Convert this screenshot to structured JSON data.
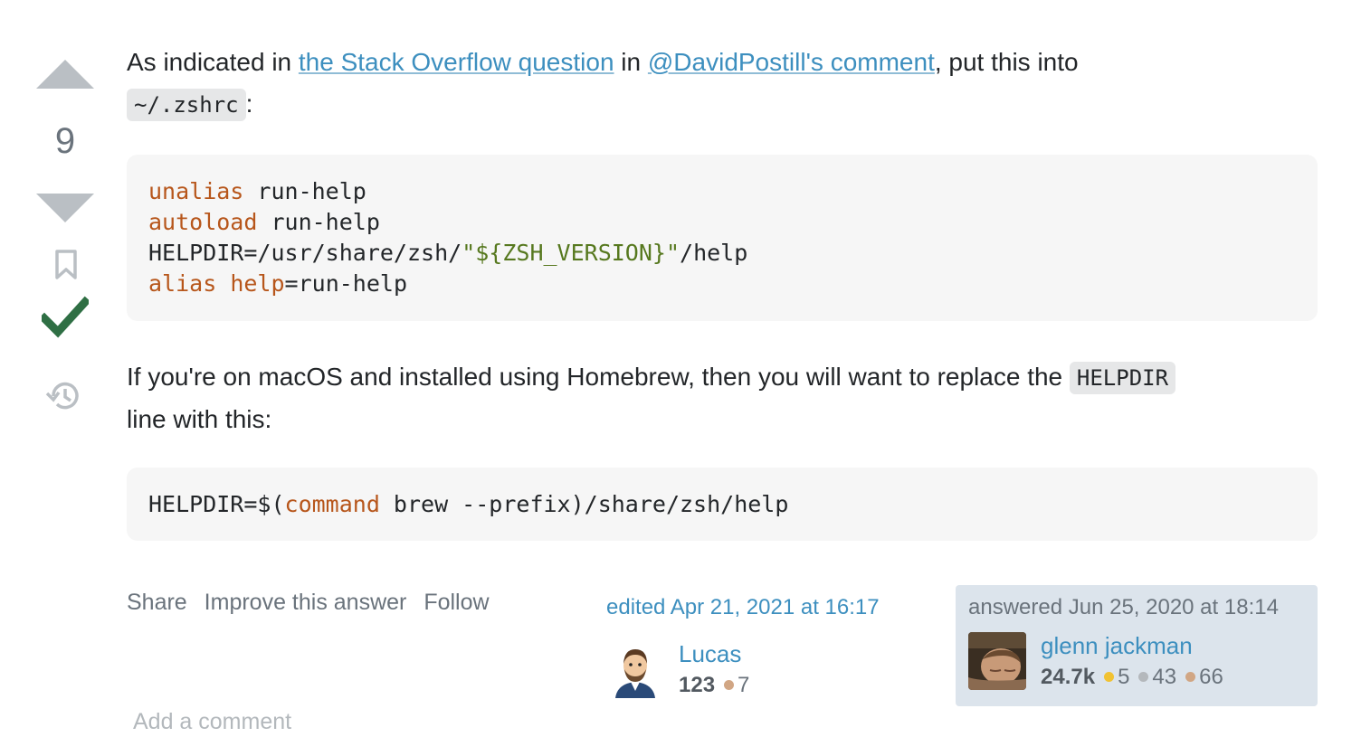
{
  "vote": {
    "count": "9"
  },
  "post": {
    "p1_before": "As indicated in ",
    "link1": "the Stack Overflow question",
    "p1_mid": " in ",
    "link2": "@DavidPostill's comment",
    "p1_after": ", put this into",
    "p1_code": "~/.zshrc",
    "p1_end": ":",
    "code1": {
      "l1_kw": "unalias",
      "l1_rest": " run-help",
      "l2_kw": "autoload",
      "l2_rest": " run-help",
      "l3_a": "HELPDIR=/usr/share/zsh/",
      "l3_str": "\"${ZSH_VERSION}\"",
      "l3_b": "/help",
      "l4_kw1": "alias",
      "l4_sp": " ",
      "l4_kw2": "help",
      "l4_rest": "=run-help"
    },
    "p2_before": "If you're on macOS and installed using Homebrew, then you will want to replace the ",
    "p2_code": "HELPDIR",
    "p2_after": "line with this:",
    "code2": {
      "a": "HELPDIR=$(",
      "kw": "command",
      "b": " brew --prefix)/share/zsh/help"
    }
  },
  "actions": {
    "share": "Share",
    "improve": "Improve this answer",
    "follow": "Follow"
  },
  "edited": {
    "when": "edited Apr 21, 2021 at 16:17",
    "user": {
      "name": "Lucas",
      "rep": "123",
      "bronze": "7"
    }
  },
  "answered": {
    "when": "answered Jun 25, 2020 at 18:14",
    "user": {
      "name": "glenn jackman",
      "rep": "24.7k",
      "gold": "5",
      "silver": "43",
      "bronze": "66"
    }
  },
  "comments": {
    "add": "Add a comment"
  },
  "colors": {
    "link": "#3d8fbf",
    "gold": "#f1c232",
    "silver": "#b4b8bc",
    "bronze": "#d1a684",
    "accepted": "#2f6f44"
  }
}
